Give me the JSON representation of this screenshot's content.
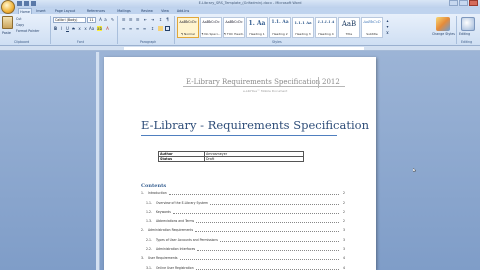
{
  "window": {
    "title": "E-Library_SRS_Template_(Grifadmin).docx - Microsoft Word"
  },
  "tabs": [
    {
      "label": "Home",
      "active": true
    },
    {
      "label": "Insert"
    },
    {
      "label": "Page Layout"
    },
    {
      "label": "References"
    },
    {
      "label": "Mailings"
    },
    {
      "label": "Review"
    },
    {
      "label": "View"
    },
    {
      "label": "Add-Ins"
    }
  ],
  "ribbon": {
    "clipboard": {
      "paste": "Paste",
      "cut": "Cut",
      "copy": "Copy",
      "format_painter": "Format Painter",
      "group": "Clipboard"
    },
    "font": {
      "name": "Calibri (Body)",
      "size": "11",
      "group": "Font"
    },
    "paragraph": {
      "group": "Paragraph"
    },
    "styles": {
      "group": "Styles",
      "items": [
        {
          "sample": "AaBbCcDc",
          "name": "¶ Normal",
          "selected": true
        },
        {
          "sample": "AaBbCcDc",
          "name": "¶ No Spaci..."
        },
        {
          "sample": "AaBbCcDc",
          "name": "¶ TOC Headi..."
        },
        {
          "sample": "1. Aa",
          "name": "Heading 1"
        },
        {
          "sample": "1.1. Aa",
          "name": "Heading 2"
        },
        {
          "sample": "1.1.1 Aa",
          "name": "Heading 3"
        },
        {
          "sample": "1.1.1.1 A",
          "name": "Heading 4"
        },
        {
          "sample": "AaB",
          "name": "Title"
        },
        {
          "sample": "AaBbCcD",
          "name": "Subtitle"
        }
      ],
      "change_styles": "Change Styles"
    },
    "editing": {
      "label": "Editing",
      "group": "Editing"
    }
  },
  "document": {
    "header_title": "E-Library Requirements Specification",
    "header_year": "2012",
    "header_sub": "e-LibHive™ Mobile Document",
    "title": "E-Library - Requirements Specification",
    "meta": [
      {
        "key": "Author",
        "value": "Amrasmeyer"
      },
      {
        "key": "Status",
        "value": "Draft"
      }
    ],
    "contents_heading": "Contents",
    "toc": [
      {
        "num": "1.",
        "text": "Introduction",
        "page": "2",
        "level": 1
      },
      {
        "num": "1.1.",
        "text": "Overview of the E-Library System",
        "page": "2",
        "level": 2
      },
      {
        "num": "1.2.",
        "text": "Keywords",
        "page": "2",
        "level": 2
      },
      {
        "num": "1.3.",
        "text": "Abbreviations and Terms",
        "page": "2",
        "level": 2
      },
      {
        "num": "2.",
        "text": "Administration Requirements",
        "page": "3",
        "level": 1
      },
      {
        "num": "2.1.",
        "text": "Types of User Accounts and Permissions",
        "page": "3",
        "level": 2
      },
      {
        "num": "2.2.",
        "text": "Administration Interfaces",
        "page": "3",
        "level": 2
      },
      {
        "num": "3.",
        "text": "User Requirements",
        "page": "4",
        "level": 1
      },
      {
        "num": "3.1.",
        "text": "Online User Registration",
        "page": "4",
        "level": 2
      }
    ]
  }
}
